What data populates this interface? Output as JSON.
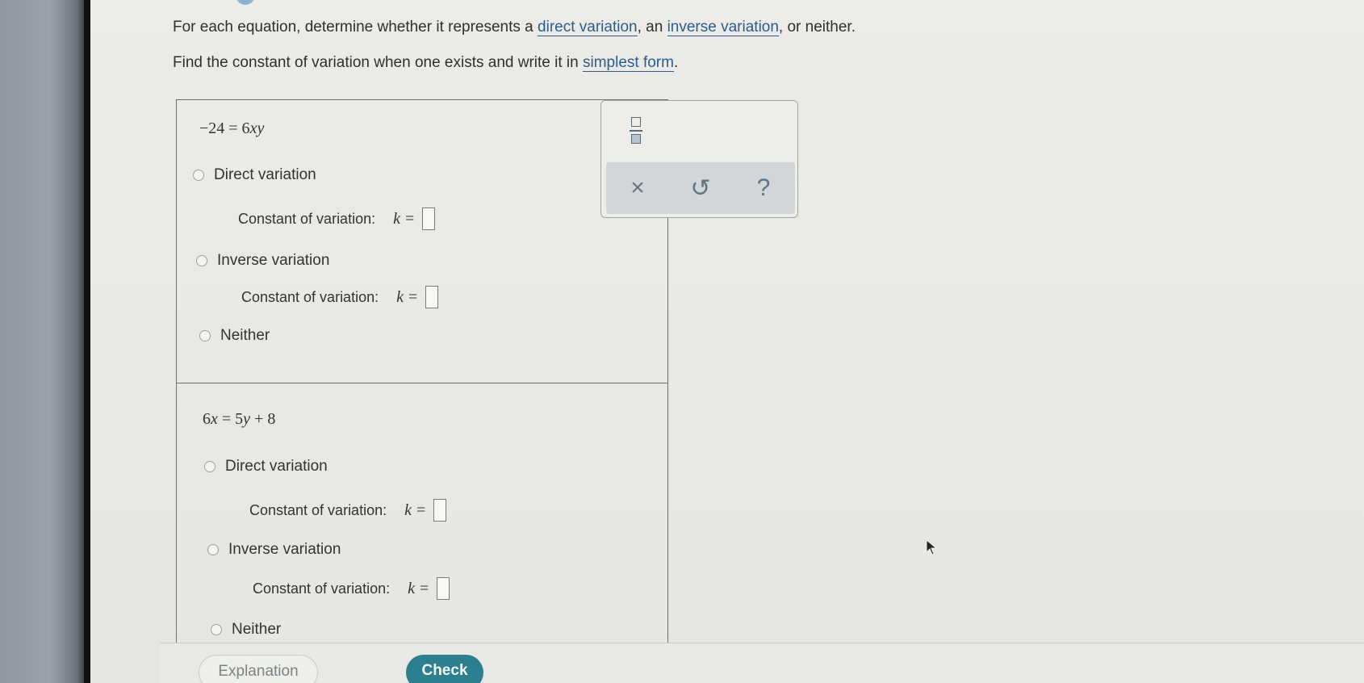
{
  "instructions": {
    "line1_before": "For each equation, determine whether it represents a ",
    "link_direct": "direct variation",
    "line1_middle": ", an ",
    "link_inverse": "inverse variation",
    "line1_after": ", or neither.",
    "line2_before": "Find the constant of variation when one exists and write it in ",
    "link_simplest": "simplest form",
    "line2_after": "."
  },
  "problems": [
    {
      "equation": "−24 = 6xy",
      "options": [
        {
          "label": "Direct variation",
          "constant_label": "Constant of variation:",
          "k_label": "k",
          "eq": "=",
          "value": ""
        },
        {
          "label": "Inverse variation",
          "constant_label": "Constant of variation:",
          "k_label": "k",
          "eq": "=",
          "value": ""
        },
        {
          "label": "Neither"
        }
      ]
    },
    {
      "equation": "6x = 5y + 8",
      "options": [
        {
          "label": "Direct variation",
          "constant_label": "Constant of variation:",
          "k_label": "k",
          "eq": "=",
          "value": ""
        },
        {
          "label": "Inverse variation",
          "constant_label": "Constant of variation:",
          "k_label": "k",
          "eq": "=",
          "value": ""
        },
        {
          "label": "Neither"
        }
      ]
    }
  ],
  "tools": {
    "clear": "×",
    "undo": "↺",
    "help": "?"
  },
  "buttons": {
    "explanation": "Explanation",
    "check": "Check"
  },
  "colors": {
    "link": "#2a5d8a",
    "check_button": "#2b7f8e",
    "tool_icon": "#5d7585"
  }
}
